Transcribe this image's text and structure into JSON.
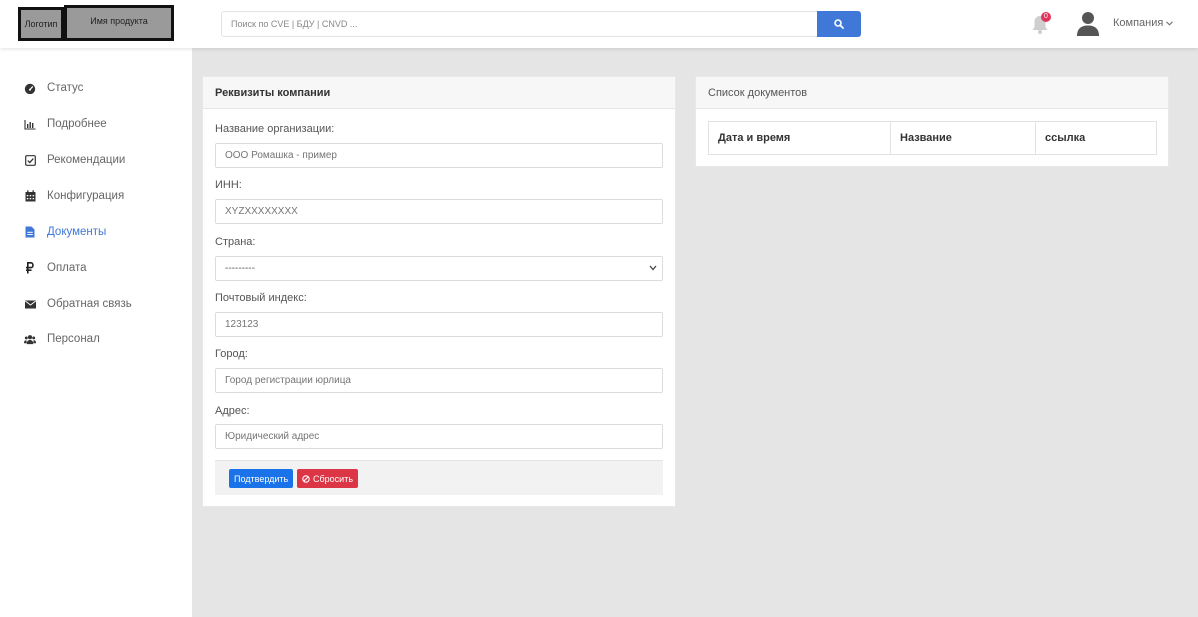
{
  "header": {
    "logo_label": "Логотип",
    "product_label": "Имя продукта",
    "search_placeholder": "Поиск по CVE | БДУ | CNVD ...",
    "notification_count": "0",
    "company_menu_label": "Компания"
  },
  "sidebar": {
    "items": [
      {
        "label": "Статус",
        "icon": "dashboard-icon"
      },
      {
        "label": "Подробнее",
        "icon": "bar-chart-icon"
      },
      {
        "label": "Рекомендации",
        "icon": "check-square-icon"
      },
      {
        "label": "Конфигурация",
        "icon": "calendar-icon"
      },
      {
        "label": "Документы",
        "icon": "file-icon",
        "active": true
      },
      {
        "label": "Оплата",
        "icon": "ruble-icon"
      },
      {
        "label": "Обратная связь",
        "icon": "envelope-icon"
      },
      {
        "label": "Персонал",
        "icon": "users-icon"
      }
    ]
  },
  "company_form": {
    "title": "Реквизиты компании",
    "fields": {
      "org_name": {
        "label": "Название организации:",
        "placeholder": "ООО Ромашка - пример"
      },
      "inn": {
        "label": "ИНН:",
        "placeholder": "XYZXXXXXXXX"
      },
      "country": {
        "label": "Страна:",
        "value": "---------"
      },
      "postal_code": {
        "label": "Почтовый индекс:",
        "placeholder": "123123"
      },
      "city": {
        "label": "Город:",
        "placeholder": "Город регистрации юрлица"
      },
      "address": {
        "label": "Адрес:",
        "placeholder": "Юридический адрес"
      }
    },
    "submit_label": "Подтвердить",
    "reset_label": "Сбросить"
  },
  "documents": {
    "title": "Список документов",
    "columns": [
      "Дата и время",
      "Название",
      "ссылка"
    ]
  },
  "colors": {
    "accent": "#3f78d6",
    "primary_button": "#1a73e8",
    "danger_button": "#dc3545",
    "badge": "#e0345b",
    "background": "#e5e5e5"
  }
}
